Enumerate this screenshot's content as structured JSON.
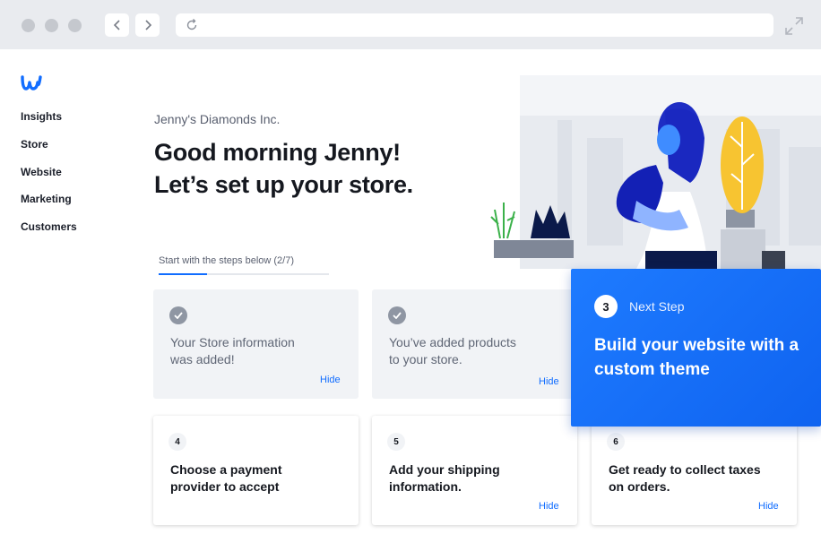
{
  "browser": {
    "window_controls": [
      "close",
      "minimize",
      "maximize"
    ],
    "back_icon": "chevron-left-icon",
    "forward_icon": "chevron-right-icon",
    "reload_icon": "reload-icon",
    "expand_icon": "expand-icon"
  },
  "brand": {
    "logo_icon": "weebly-logo",
    "color": "#116dff"
  },
  "sidebar": {
    "items": [
      {
        "label": "Insights"
      },
      {
        "label": "Store"
      },
      {
        "label": "Website"
      },
      {
        "label": "Marketing"
      },
      {
        "label": "Customers"
      }
    ]
  },
  "header": {
    "company": "Jenny's Diamonds Inc.",
    "greeting_line1": "Good morning Jenny!",
    "greeting_line2": "Let’s set up your store."
  },
  "steps": {
    "label": "Start with the steps below (2/7)",
    "completed": 2,
    "total": 7
  },
  "completed_cards": [
    {
      "line1": "Your Store information",
      "line2": "was added!",
      "hide": "Hide",
      "icon": "check-icon"
    },
    {
      "line1": "You’ve added products",
      "line2": "to your store.",
      "hide": "Hide",
      "icon": "check-icon"
    }
  ],
  "todo_cards": [
    {
      "num": "4",
      "line1": "Choose a payment",
      "line2": "provider to accept",
      "hide": ""
    },
    {
      "num": "5",
      "line1": "Add your shipping",
      "line2": "information.",
      "hide": "Hide"
    },
    {
      "num": "6",
      "line1": "Get ready to collect taxes",
      "line2": "on orders.",
      "hide": "Hide"
    }
  ],
  "next_step": {
    "num": "3",
    "label": "Next Step",
    "title": "Build your website with a custom theme",
    "color": "#1e7bff"
  }
}
